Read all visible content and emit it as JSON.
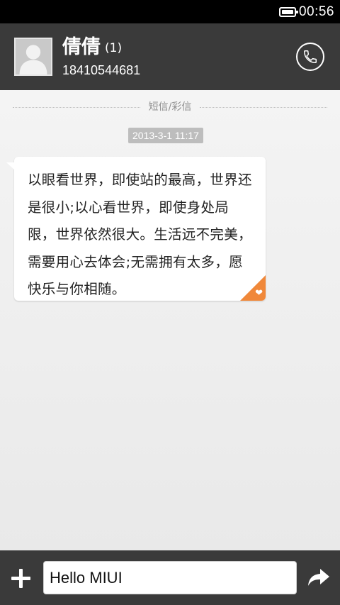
{
  "status_bar": {
    "time": "00:56",
    "battery_level": 1.0
  },
  "header": {
    "contact_name": "倩倩",
    "unread_count": "(1)",
    "phone_number": "18410544681",
    "icons": {
      "avatar": "default-person-avatar",
      "call": "phone-icon"
    }
  },
  "conversation": {
    "divider_label": "短信/彩信",
    "timestamp": "2013-3-1 11:17",
    "messages": [
      {
        "text": "以眼看世界，即使站的最高，世界还是很小;以心看世界，即使身处局限，世界依然很大。生活远不完美，需要用心去体会;无需拥有太多，愿快乐与你相随。",
        "favorite_icon": "heart-icon"
      }
    ]
  },
  "compose": {
    "input_value": "Hello MIUI",
    "icons": {
      "attach": "plus-icon",
      "send": "send-arrow-icon"
    }
  },
  "colors": {
    "header_bg": "#3a3a3a",
    "status_bg": "#000000",
    "accent_orange": "#f0883a",
    "timestamp_bg": "#bdbdbd"
  }
}
